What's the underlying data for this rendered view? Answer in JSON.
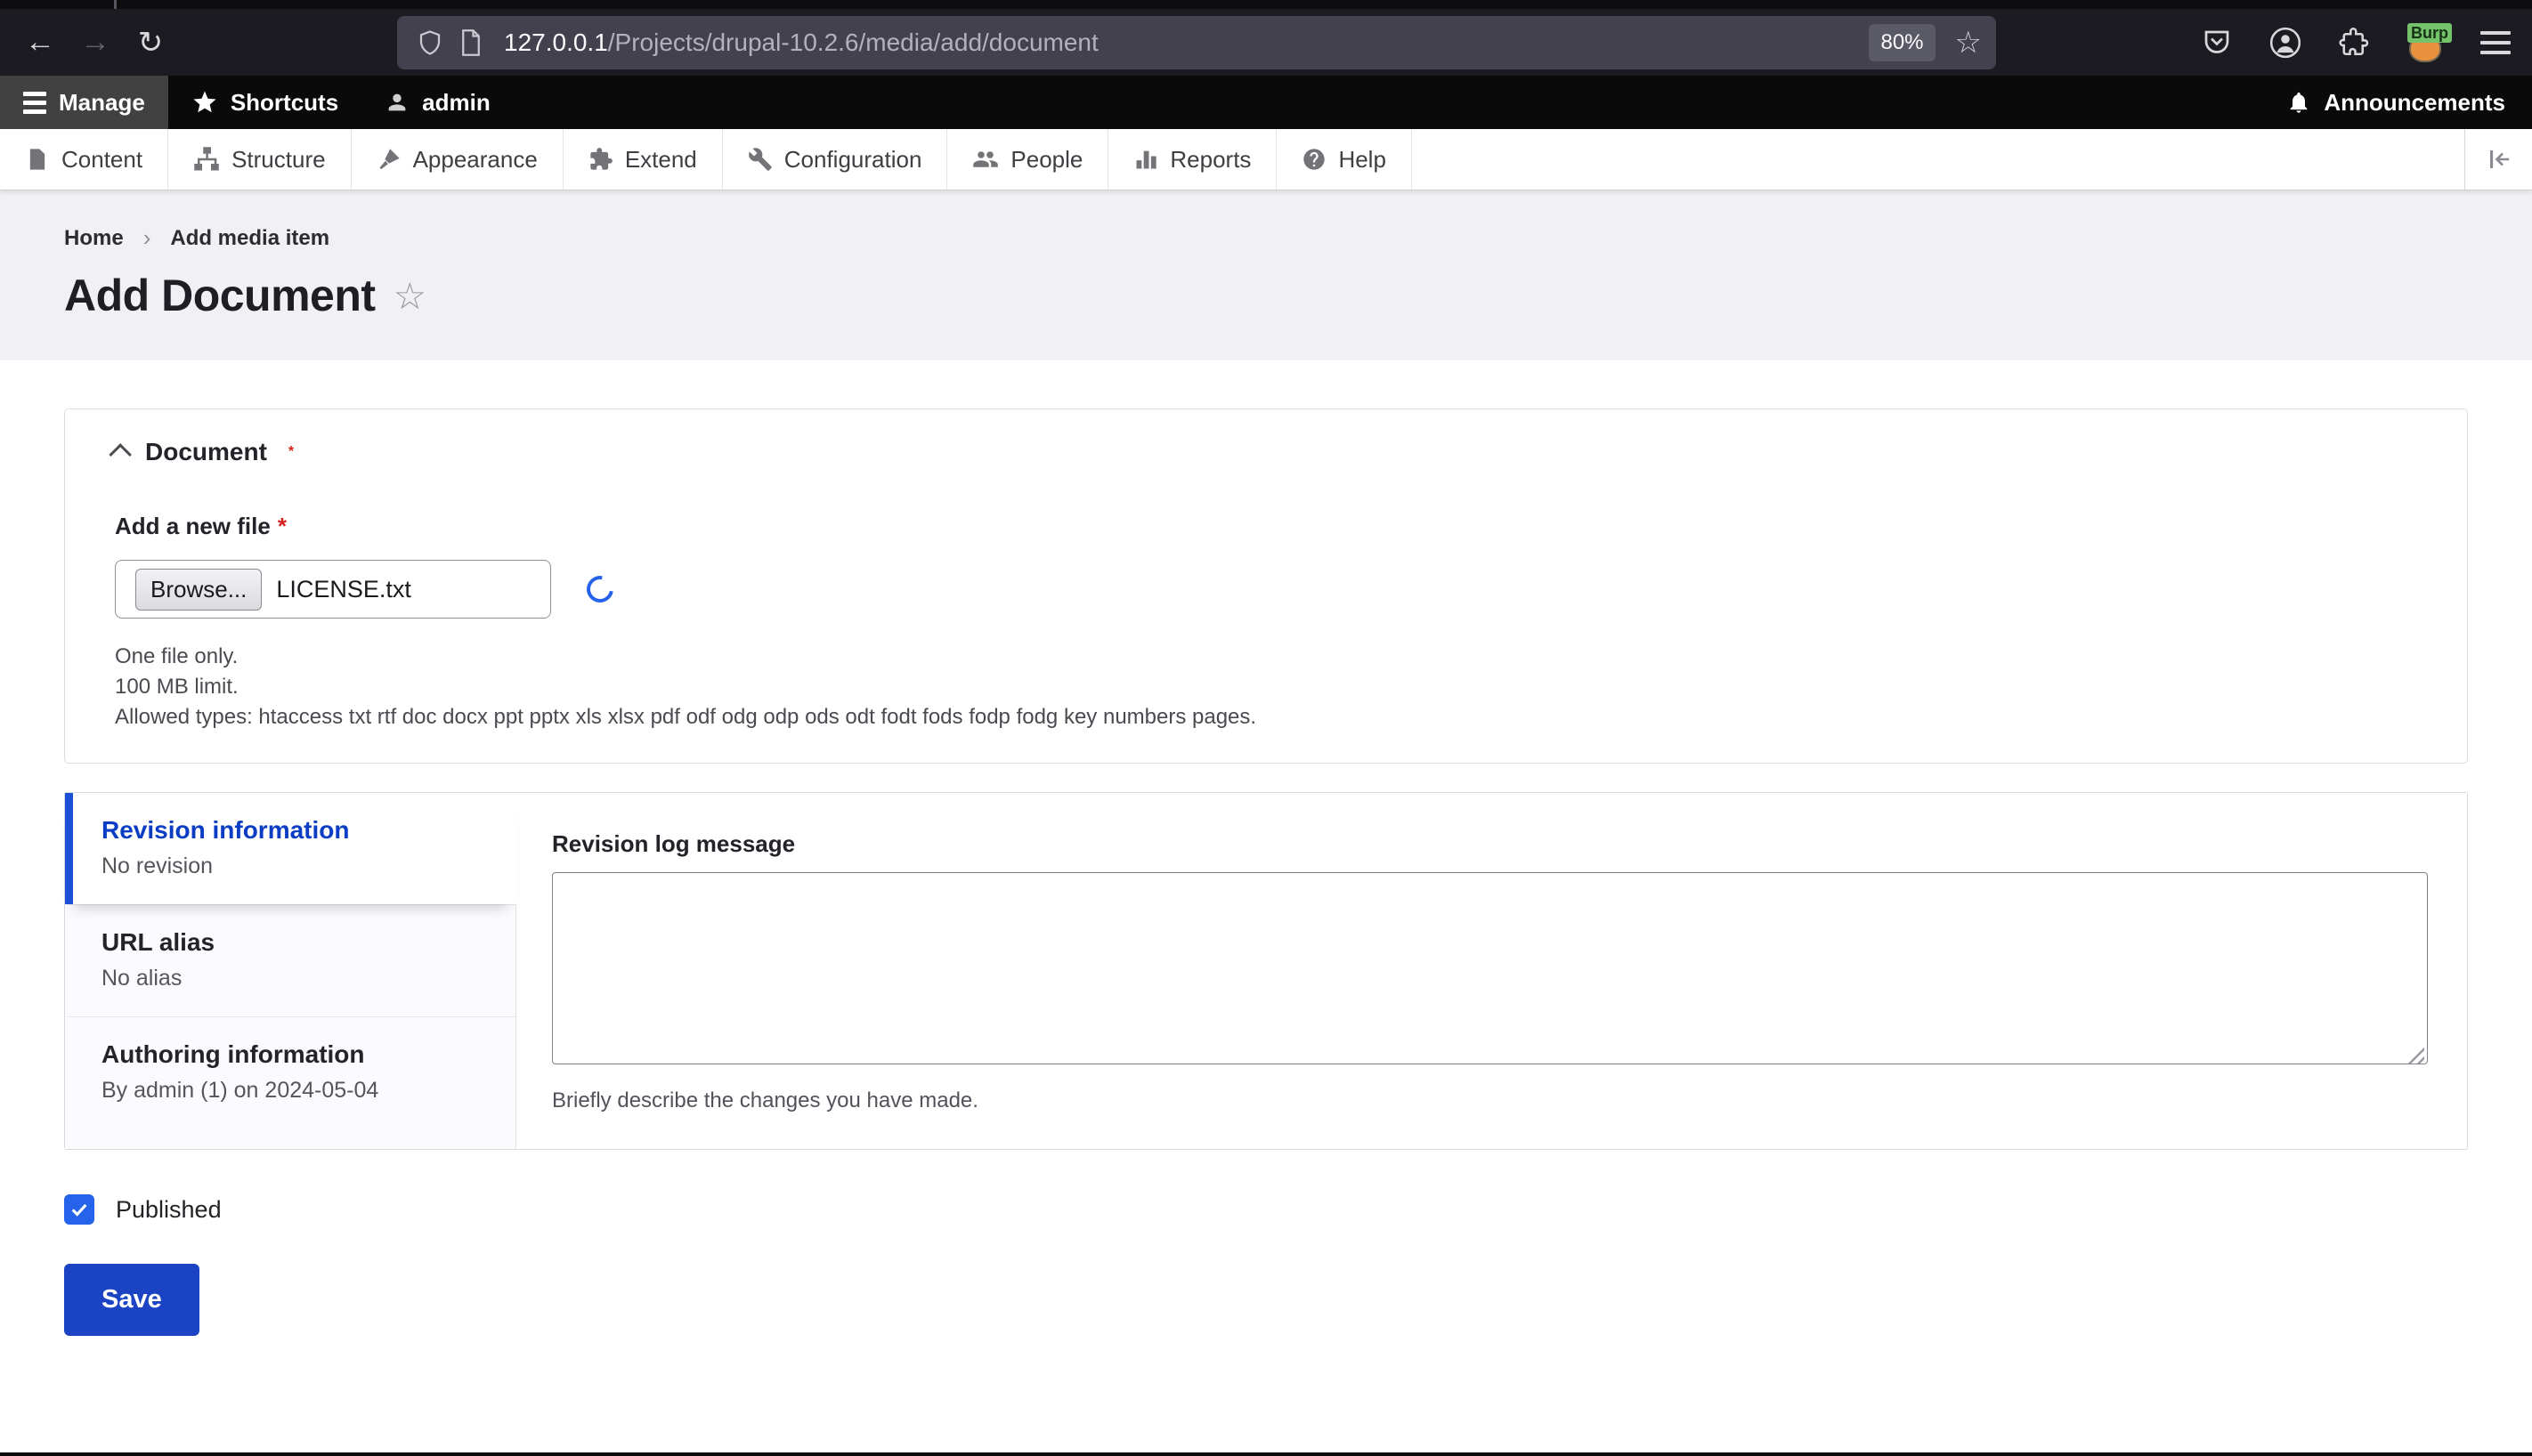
{
  "browser": {
    "url_domain": "127.0.0.1",
    "url_path": "/Projects/drupal-10.2.6/media/add/document",
    "zoom_badge": "80%",
    "extension_badge": "Burp"
  },
  "glyphs": {
    "back_arrow": "←",
    "forward_arrow": "→",
    "reload": "↻",
    "bookmark_star": "☆",
    "breadcrumb_separator": "›",
    "title_star": "☆"
  },
  "admin_toolbar": {
    "manage_label": "Manage",
    "shortcuts_label": "Shortcuts",
    "user_label": "admin",
    "announcements_label": "Announcements"
  },
  "nav_toolbar": {
    "items": [
      {
        "label": "Content"
      },
      {
        "label": "Structure"
      },
      {
        "label": "Appearance"
      },
      {
        "label": "Extend"
      },
      {
        "label": "Configuration"
      },
      {
        "label": "People"
      },
      {
        "label": "Reports"
      },
      {
        "label": "Help"
      }
    ]
  },
  "breadcrumb": {
    "home_label": "Home",
    "current_label": "Add media item"
  },
  "page": {
    "title": "Add Document"
  },
  "required_marker": "*",
  "document_fieldset": {
    "legend": "Document",
    "file_label": "Add a new file",
    "browse_label": "Browse...",
    "file_name": "LICENSE.txt",
    "descriptions": [
      "One file only.",
      "100 MB limit.",
      "Allowed types: htaccess txt rtf doc docx ppt pptx xls xlsx pdf odf odg odp ods odt fodt fods fodp fodg key numbers pages."
    ]
  },
  "vertical_tabs": {
    "tabs": [
      {
        "label": "Revision information",
        "summary": "No revision"
      },
      {
        "label": "URL alias",
        "summary": "No alias"
      },
      {
        "label": "Authoring information",
        "summary": "By admin (1) on 2024-05-04"
      }
    ],
    "panel": {
      "label": "Revision log message",
      "help": "Briefly describe the changes you have made."
    }
  },
  "publish": {
    "checkbox_label": "Published"
  },
  "actions": {
    "save_label": "Save"
  },
  "colors": {
    "accent_blue": "#1d4fd7",
    "link_blue": "#0a3dc4",
    "checkbox_blue": "#2563eb",
    "button_blue": "#1b44c4",
    "required_red": "#d72222",
    "chrome_bg": "#1c1b22",
    "urlbar_bg": "#42414d",
    "header_bg": "#f1f1f5"
  }
}
